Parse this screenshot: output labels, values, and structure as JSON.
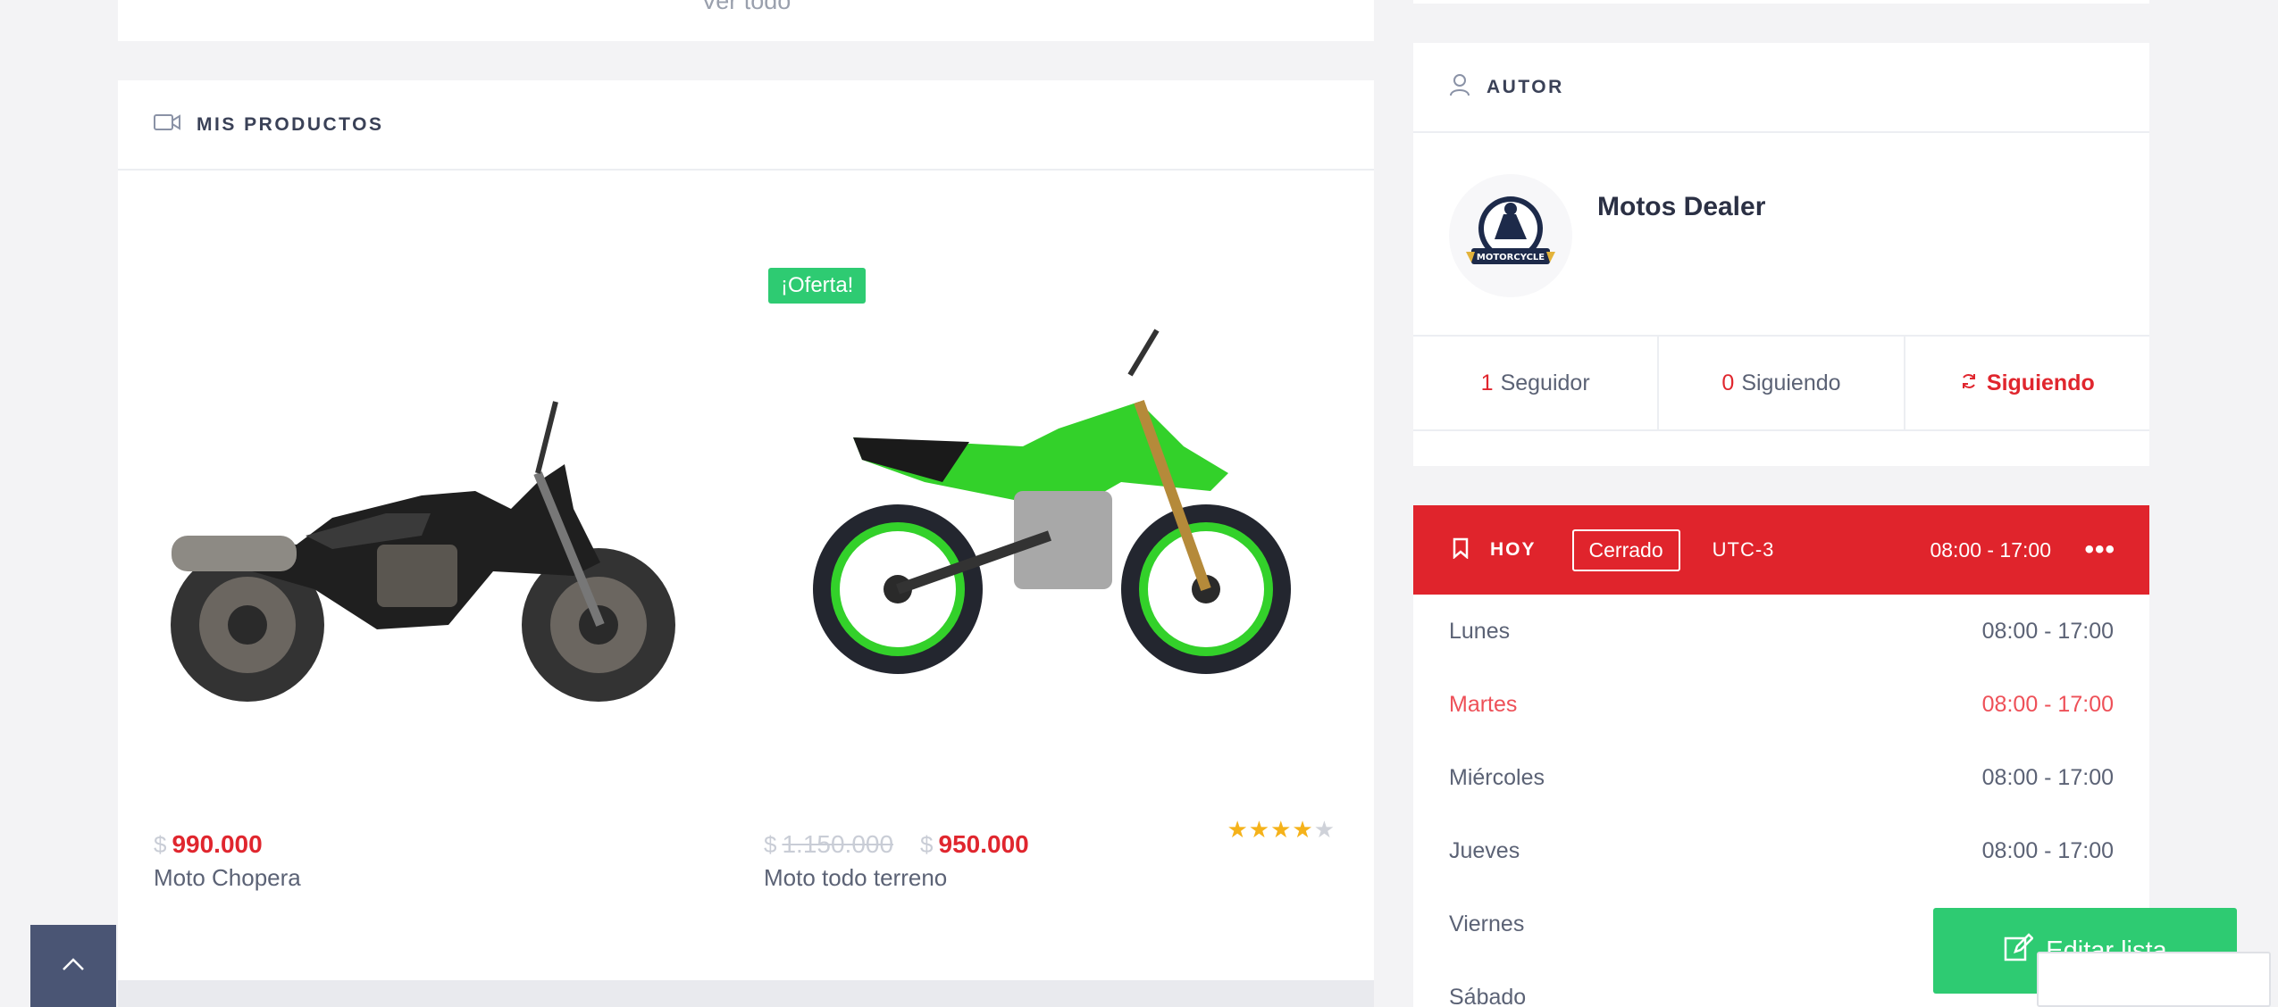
{
  "top_card": {
    "link_label": "Ver todo"
  },
  "products_section": {
    "title": "MIS PRODUCTOS",
    "items": [
      {
        "name": "Moto Chopera",
        "currency": "$",
        "price": "990.000",
        "image_color": "#2a2a2a"
      },
      {
        "name": "Moto todo terreno",
        "badge": "¡Oferta!",
        "currency": "$",
        "old_price": "1.150.000",
        "price": "950.000",
        "rating": 4,
        "rating_max": 5,
        "image_color": "#33d12a"
      }
    ]
  },
  "author": {
    "section_title": "AUTOR",
    "name": "Motos Dealer",
    "avatar_text": "MOTORCYCLE",
    "followers_count": "1",
    "followers_label": "Seguidor",
    "following_count": "0",
    "following_label": "Siguiendo",
    "follow_action": "Siguiendo"
  },
  "hours": {
    "today_label": "HOY",
    "status": "Cerrado",
    "timezone": "UTC-3",
    "today_range": "08:00 - 17:00",
    "days": [
      {
        "day": "Lunes",
        "range": "08:00 - 17:00"
      },
      {
        "day": "Martes",
        "range": "08:00 - 17:00"
      },
      {
        "day": "Miércoles",
        "range": "08:00 - 17:00"
      },
      {
        "day": "Jueves",
        "range": "08:00 - 17:00"
      },
      {
        "day": "Viernes",
        "range": ""
      },
      {
        "day": "Sábado",
        "range": ""
      }
    ]
  },
  "floating": {
    "edit_list_label": "Editar lista"
  },
  "colors": {
    "accent_red": "#e0242c",
    "success_green": "#2ecb72",
    "dark_slate": "#4a5574"
  }
}
